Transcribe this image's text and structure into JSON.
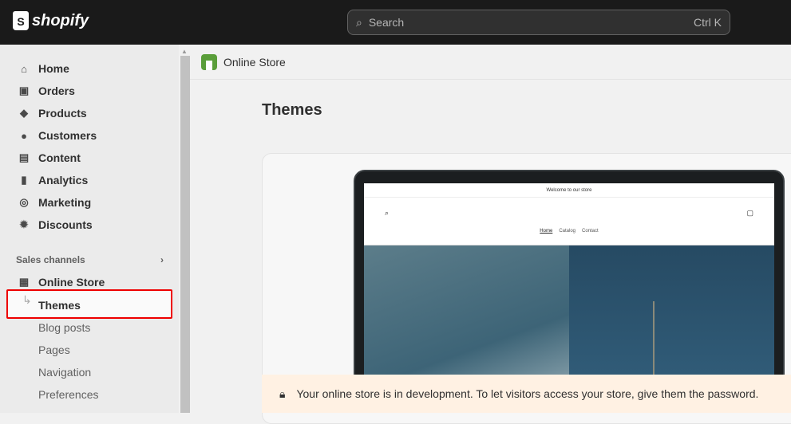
{
  "topbar": {
    "brand": "shopify",
    "search_placeholder": "Search",
    "search_shortcut": "Ctrl K"
  },
  "sidebar": {
    "items": [
      {
        "label": "Home",
        "icon": "home-icon"
      },
      {
        "label": "Orders",
        "icon": "inbox-icon"
      },
      {
        "label": "Products",
        "icon": "tag-icon"
      },
      {
        "label": "Customers",
        "icon": "person-icon"
      },
      {
        "label": "Content",
        "icon": "image-icon"
      },
      {
        "label": "Analytics",
        "icon": "bar-chart-icon"
      },
      {
        "label": "Marketing",
        "icon": "target-icon"
      },
      {
        "label": "Discounts",
        "icon": "discount-icon"
      }
    ],
    "sales_channels": "Sales channels",
    "online_store": "Online Store",
    "sub_items": [
      "Themes",
      "Blog posts",
      "Pages",
      "Navigation",
      "Preferences"
    ],
    "selected": "Themes",
    "highlight_color": "#ee0000"
  },
  "main": {
    "breadcrumb": "Online Store",
    "title": "Themes",
    "preview": {
      "announcement": "Welcome to our store",
      "links": [
        "Home",
        "Catalog",
        "Contact"
      ]
    },
    "banner": "Your online store is in development. To let visitors access your store, give them the password."
  }
}
